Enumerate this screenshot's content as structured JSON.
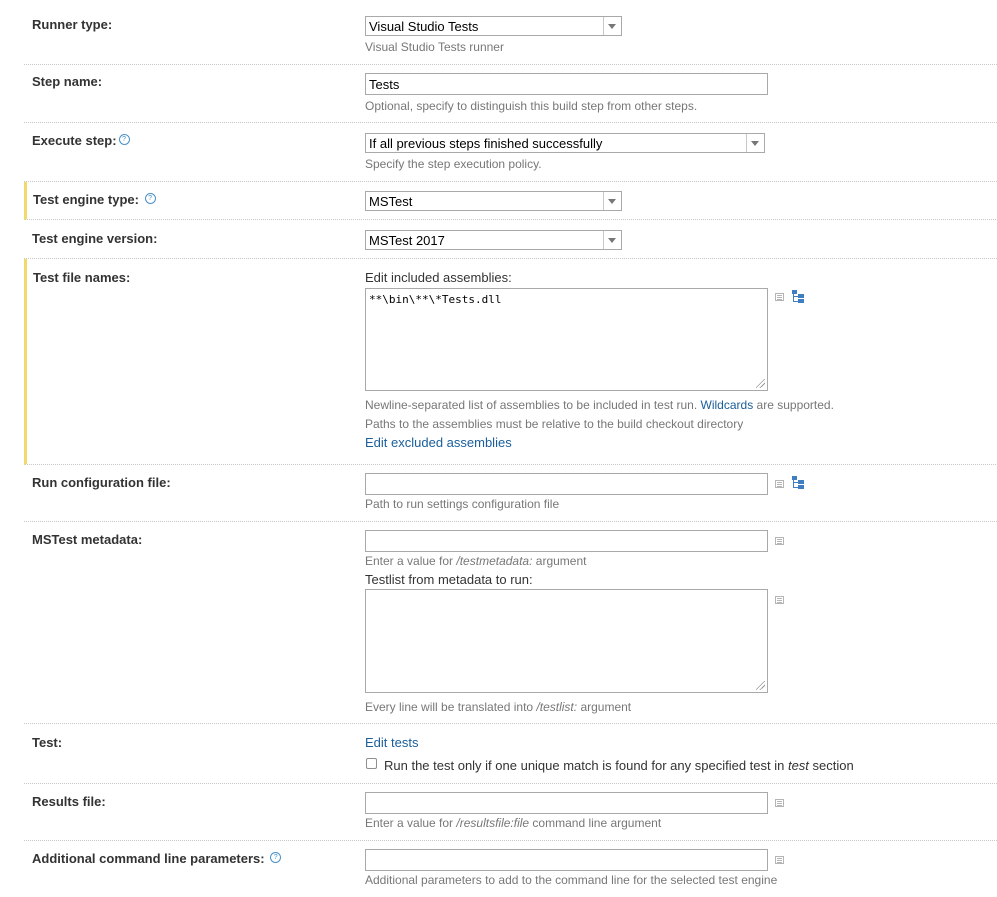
{
  "runner_type": {
    "label": "Runner type:",
    "value": "Visual Studio Tests",
    "note": "Visual Studio Tests runner"
  },
  "step_name": {
    "label": "Step name:",
    "value": "Tests",
    "note": "Optional, specify to distinguish this build step from other steps."
  },
  "execute_step": {
    "label": "Execute step:",
    "value": "If all previous steps finished successfully",
    "note": "Specify the step execution policy."
  },
  "test_engine_type": {
    "label": "Test engine type:",
    "value": "MSTest"
  },
  "test_engine_version": {
    "label": "Test engine version:",
    "value": "MSTest 2017"
  },
  "test_file_names": {
    "label": "Test file names:",
    "sublabel": "Edit included assemblies:",
    "value": "**\\bin\\**\\*Tests.dll",
    "note1_pre": "Newline-separated list of assemblies to be included in test run. ",
    "note1_link": "Wildcards",
    "note1_post": " are supported.",
    "note2": "Paths to the assemblies must be relative to the build checkout directory",
    "excluded_link": "Edit excluded assemblies"
  },
  "run_config": {
    "label": "Run configuration file:",
    "value": "",
    "note": "Path to run settings configuration file"
  },
  "mstest_metadata": {
    "label": "MSTest metadata:",
    "value": "",
    "note_pre": "Enter a value for ",
    "note_arg": "/testmetadata:",
    "note_post": " argument",
    "sublabel": "Testlist from metadata to run:",
    "note2_pre": "Every line will be translated into ",
    "note2_arg": "/testlist:",
    "note2_post": " argument"
  },
  "test": {
    "label": "Test:",
    "link": "Edit tests",
    "checkbox_pre": "Run the test only if one unique match is found for any specified test in ",
    "checkbox_em": "test",
    "checkbox_post": " section",
    "checked": false
  },
  "results_file": {
    "label": "Results file:",
    "value": "",
    "note_pre": "Enter a value for ",
    "note_arg": "/resultsfile:file",
    "note_post": " command line argument"
  },
  "additional_params": {
    "label": "Additional command line parameters:",
    "value": "",
    "note": "Additional parameters to add to the command line for the selected test engine"
  },
  "icons": {
    "help": "help-icon",
    "list": "list-icon",
    "tree": "tree-picker-icon",
    "dropdown": "chevron-down-icon"
  },
  "colors": {
    "highlight_border": "#f1d96c",
    "link": "#1a5e9b",
    "note": "#777777"
  }
}
